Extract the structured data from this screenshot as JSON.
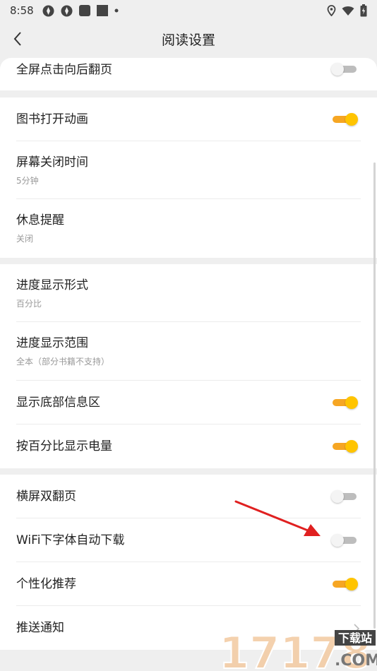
{
  "status_bar": {
    "time": "8:58",
    "left_icons": [
      "media-icon",
      "media-icon",
      "square-icon",
      "square-icon",
      "dot-icon"
    ],
    "right_icons": [
      "location-icon",
      "wifi-icon",
      "battery-icon"
    ]
  },
  "header": {
    "title": "阅读设置",
    "back_icon": "chevron-left-icon"
  },
  "group0": {
    "items": [
      {
        "label": "全屏点击向后翻页",
        "toggle": false
      }
    ]
  },
  "group1": {
    "items": [
      {
        "label": "图书打开动画",
        "toggle": true
      },
      {
        "label": "屏幕关闭时间",
        "sub": "5分钟"
      },
      {
        "label": "休息提醒",
        "sub": "关闭"
      }
    ]
  },
  "group2": {
    "items": [
      {
        "label": "进度显示形式",
        "sub": "百分比"
      },
      {
        "label": "进度显示范围",
        "sub": "全本（部分书籍不支持）"
      },
      {
        "label": "显示底部信息区",
        "toggle": true
      },
      {
        "label": "按百分比显示电量",
        "toggle": true
      }
    ]
  },
  "group3": {
    "items": [
      {
        "label": "横屏双翻页",
        "toggle": false
      },
      {
        "label": "WiFi下字体自动下载",
        "toggle": false
      },
      {
        "label": "个性化推荐",
        "toggle": true
      },
      {
        "label": "推送通知",
        "chevron": true
      }
    ]
  },
  "watermark": {
    "number": "17178",
    "tag": "下载站",
    "suffix": ".COM"
  },
  "colors": {
    "accent_knob": "#ffc400",
    "accent_track": "#f6a623",
    "off_track": "#bdbdbd",
    "annotation_arrow": "#e02020",
    "background": "#efefef",
    "card": "#ffffff"
  }
}
